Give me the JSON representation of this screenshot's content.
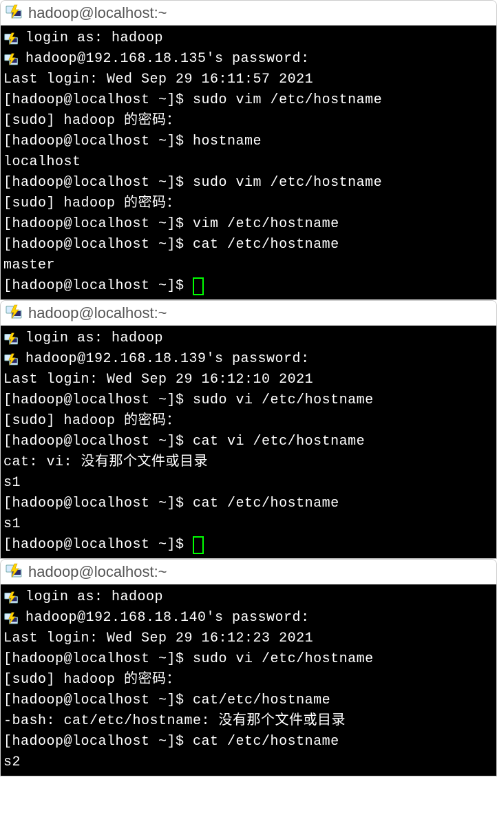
{
  "windows": [
    {
      "title": "hadoop@localhost:~",
      "lines": [
        {
          "icon": true,
          "text": "login as: hadoop"
        },
        {
          "icon": true,
          "text": "hadoop@192.168.18.135's password:"
        },
        {
          "icon": false,
          "text": "Last login: Wed Sep 29 16:11:57 2021"
        },
        {
          "icon": false,
          "text": "[hadoop@localhost ~]$ sudo vim /etc/hostname"
        },
        {
          "icon": false,
          "text": "[sudo] hadoop 的密码："
        },
        {
          "icon": false,
          "text": "[hadoop@localhost ~]$ hostname"
        },
        {
          "icon": false,
          "text": "localhost"
        },
        {
          "icon": false,
          "text": "[hadoop@localhost ~]$ sudo vim /etc/hostname"
        },
        {
          "icon": false,
          "text": "[sudo] hadoop 的密码："
        },
        {
          "icon": false,
          "text": "[hadoop@localhost ~]$ vim /etc/hostname"
        },
        {
          "icon": false,
          "text": "[hadoop@localhost ~]$ cat /etc/hostname"
        },
        {
          "icon": false,
          "text": "master"
        },
        {
          "icon": false,
          "text": "[hadoop@localhost ~]$ ",
          "cursor": "outline"
        }
      ]
    },
    {
      "title": "hadoop@localhost:~",
      "lines": [
        {
          "icon": true,
          "text": "login as: hadoop"
        },
        {
          "icon": true,
          "text": "hadoop@192.168.18.139's password:"
        },
        {
          "icon": false,
          "text": "Last login: Wed Sep 29 16:12:10 2021"
        },
        {
          "icon": false,
          "text": "[hadoop@localhost ~]$ sudo vi /etc/hostname"
        },
        {
          "icon": false,
          "text": "[sudo] hadoop 的密码："
        },
        {
          "icon": false,
          "text": "[hadoop@localhost ~]$ cat vi /etc/hostname"
        },
        {
          "icon": false,
          "text": "cat: vi: 没有那个文件或目录"
        },
        {
          "icon": false,
          "text": "s1"
        },
        {
          "icon": false,
          "text": "[hadoop@localhost ~]$ cat /etc/hostname"
        },
        {
          "icon": false,
          "text": "s1"
        },
        {
          "icon": false,
          "text": "[hadoop@localhost ~]$ ",
          "cursor": "outline"
        }
      ]
    },
    {
      "title": "hadoop@localhost:~",
      "lines": [
        {
          "icon": true,
          "text": "login as: hadoop"
        },
        {
          "icon": true,
          "text": "hadoop@192.168.18.140's password:"
        },
        {
          "icon": false,
          "text": "Last login: Wed Sep 29 16:12:23 2021"
        },
        {
          "icon": false,
          "text": "[hadoop@localhost ~]$ sudo vi /etc/hostname"
        },
        {
          "icon": false,
          "text": "[sudo] hadoop 的密码："
        },
        {
          "icon": false,
          "text": "[hadoop@localhost ~]$ cat/etc/hostname"
        },
        {
          "icon": false,
          "text": "-bash: cat/etc/hostname: 没有那个文件或目录"
        },
        {
          "icon": false,
          "text": "[hadoop@localhost ~]$ cat /etc/hostname"
        },
        {
          "icon": false,
          "text": "s2"
        }
      ]
    }
  ]
}
